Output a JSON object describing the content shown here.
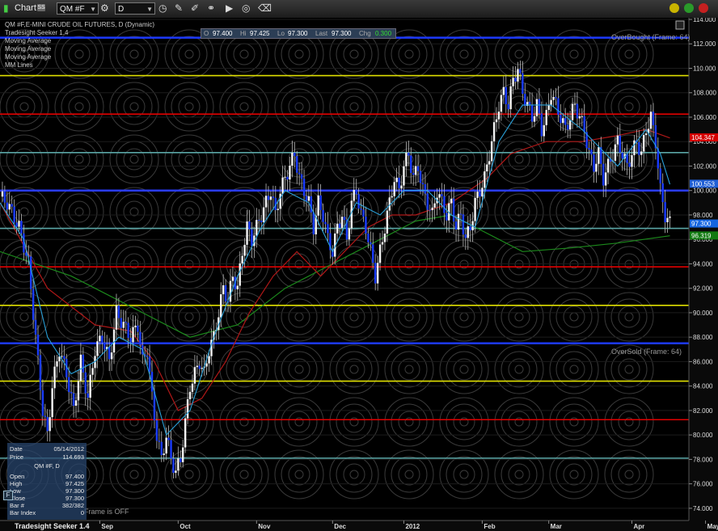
{
  "toolbar": {
    "title": "Chart",
    "badge": "SS",
    "symbol": "QM #F",
    "period": "D",
    "icons": [
      "link-icon",
      "crosshair-icon",
      "pencil-icon",
      "draw-icon",
      "play-icon",
      "target-icon",
      "eraser-icon"
    ]
  },
  "legend": {
    "title": "QM #F,E-MINI CRUDE OIL FUTURES, D (Dynamic)",
    "lines": [
      "Tradesight Seeker 1.4",
      "Moving Average",
      "Moving Average",
      "Moving Average",
      "MM Lines"
    ]
  },
  "ohlc": {
    "o_label": "O",
    "o": "97.400",
    "h_label": "Hi",
    "h": "97.425",
    "l_label": "Lo",
    "l": "97.300",
    "last_label": "Last",
    "last": "97.300",
    "chg_label": "Chg",
    "chg": "0.300"
  },
  "labels": {
    "overbought": "OverBought (Frame: 64)",
    "oversold": "OverSold (Frame: 64)",
    "frame_off": "Frame is OFF",
    "footer": "Tradesight Seeker 1.4"
  },
  "info_panel": {
    "date_label": "Date",
    "date": "05/14/2012",
    "price_label": "Price",
    "price": "114.693",
    "symbol": "QM #F, D",
    "rows": [
      {
        "label": "Open",
        "value": "97.400"
      },
      {
        "label": "High",
        "value": "97.425"
      },
      {
        "label": "Low",
        "value": "97.300"
      },
      {
        "label": "Close",
        "value": "97.300"
      },
      {
        "label": "Bar #",
        "value": "382/382"
      },
      {
        "label": "Bar Index",
        "value": "0"
      }
    ]
  },
  "price_tags": [
    {
      "value": "104.347",
      "color": "#d40000"
    },
    {
      "value": "100.553",
      "color": "#1f5fd6"
    },
    {
      "value": "97.300",
      "color": "#1565e0"
    },
    {
      "value": "96.319",
      "color": "#117a11"
    }
  ],
  "chart_data": {
    "type": "candlestick",
    "title": "QM #F,E-MINI CRUDE OIL FUTURES, D (Dynamic)",
    "ylim": [
      73,
      114
    ],
    "y_ticks": [
      74,
      76,
      78,
      80,
      82,
      84,
      86,
      88,
      90,
      92,
      94,
      96,
      98,
      100,
      102,
      104,
      106,
      108,
      110,
      112,
      114
    ],
    "x_ticks": [
      "Sep",
      "Oct",
      "Nov",
      "Dec",
      "2012",
      "Feb",
      "Mar",
      "Apr",
      "May"
    ],
    "x_tick_index": [
      42,
      75,
      108,
      140,
      170,
      203,
      231,
      266,
      297
    ],
    "mm_lines": [
      {
        "value": 112.5,
        "color": "#1d39ff"
      },
      {
        "value": 109.4,
        "color": "#e0e000"
      },
      {
        "value": 106.25,
        "color": "#e00000"
      },
      {
        "value": 103.1,
        "color": "#5aa6a6"
      },
      {
        "value": 100.0,
        "color": "#2a3cff"
      },
      {
        "value": 96.9,
        "color": "#5aa6a6"
      },
      {
        "value": 93.75,
        "color": "#e00000"
      },
      {
        "value": 90.6,
        "color": "#e0e000"
      },
      {
        "value": 87.5,
        "color": "#1d39ff"
      },
      {
        "value": 84.4,
        "color": "#e0e000"
      },
      {
        "value": 81.25,
        "color": "#e00000"
      },
      {
        "value": 78.1,
        "color": "#5aa6a6"
      }
    ],
    "close_path": [
      [
        0,
        99.5
      ],
      [
        3,
        99
      ],
      [
        8,
        97
      ],
      [
        12,
        94
      ],
      [
        14,
        90
      ],
      [
        16,
        86
      ],
      [
        18,
        82
      ],
      [
        20,
        80
      ],
      [
        22,
        84
      ],
      [
        25,
        87
      ],
      [
        28,
        85
      ],
      [
        31,
        82
      ],
      [
        34,
        86
      ],
      [
        37,
        83
      ],
      [
        40,
        87
      ],
      [
        43,
        88
      ],
      [
        46,
        86
      ],
      [
        49,
        90
      ],
      [
        52,
        89
      ],
      [
        55,
        88
      ],
      [
        58,
        89
      ],
      [
        60,
        86
      ],
      [
        62,
        87
      ],
      [
        64,
        83
      ],
      [
        66,
        80
      ],
      [
        68,
        78
      ],
      [
        70,
        80
      ],
      [
        72,
        78
      ],
      [
        74,
        77
      ],
      [
        76,
        78
      ],
      [
        78,
        81
      ],
      [
        80,
        84
      ],
      [
        82,
        85
      ],
      [
        84,
        86
      ],
      [
        86,
        85
      ],
      [
        88,
        87
      ],
      [
        90,
        88
      ],
      [
        92,
        90
      ],
      [
        94,
        92
      ],
      [
        96,
        91
      ],
      [
        98,
        93
      ],
      [
        100,
        92
      ],
      [
        102,
        95
      ],
      [
        104,
        97
      ],
      [
        106,
        96
      ],
      [
        108,
        97
      ],
      [
        110,
        98
      ],
      [
        112,
        99
      ],
      [
        114,
        100
      ],
      [
        116,
        98
      ],
      [
        118,
        100
      ],
      [
        120,
        101
      ],
      [
        122,
        102
      ],
      [
        124,
        103
      ],
      [
        126,
        101
      ],
      [
        128,
        100
      ],
      [
        130,
        99
      ],
      [
        132,
        97
      ],
      [
        134,
        99
      ],
      [
        136,
        98
      ],
      [
        138,
        96
      ],
      [
        140,
        95
      ],
      [
        142,
        97
      ],
      [
        144,
        98
      ],
      [
        146,
        96
      ],
      [
        148,
        99
      ],
      [
        150,
        100
      ],
      [
        152,
        98
      ],
      [
        154,
        97
      ],
      [
        156,
        95
      ],
      [
        158,
        93
      ],
      [
        160,
        95
      ],
      [
        162,
        97
      ],
      [
        164,
        99
      ],
      [
        166,
        101
      ],
      [
        168,
        100
      ],
      [
        170,
        102
      ],
      [
        172,
        103
      ],
      [
        174,
        101
      ],
      [
        176,
        102
      ],
      [
        178,
        100
      ],
      [
        180,
        99
      ],
      [
        182,
        98
      ],
      [
        184,
        100
      ],
      [
        186,
        99
      ],
      [
        188,
        98
      ],
      [
        190,
        99
      ],
      [
        192,
        97
      ],
      [
        194,
        98
      ],
      [
        196,
        96
      ],
      [
        198,
        97
      ],
      [
        200,
        99
      ],
      [
        202,
        100
      ],
      [
        204,
        101
      ],
      [
        206,
        103
      ],
      [
        208,
        105
      ],
      [
        210,
        107
      ],
      [
        212,
        108
      ],
      [
        214,
        107
      ],
      [
        216,
        109
      ],
      [
        218,
        110
      ],
      [
        220,
        108
      ],
      [
        222,
        107
      ],
      [
        224,
        106
      ],
      [
        226,
        107
      ],
      [
        228,
        105
      ],
      [
        230,
        106
      ],
      [
        232,
        108
      ],
      [
        234,
        107
      ],
      [
        236,
        106
      ],
      [
        238,
        105
      ],
      [
        240,
        106
      ],
      [
        242,
        107
      ],
      [
        244,
        106
      ],
      [
        246,
        105
      ],
      [
        248,
        103
      ],
      [
        250,
        102
      ],
      [
        252,
        103
      ],
      [
        254,
        101
      ],
      [
        256,
        102
      ],
      [
        258,
        103
      ],
      [
        260,
        104
      ],
      [
        262,
        103
      ],
      [
        264,
        102
      ],
      [
        266,
        103
      ],
      [
        268,
        104
      ],
      [
        270,
        103
      ],
      [
        272,
        105
      ],
      [
        274,
        106
      ],
      [
        276,
        104
      ],
      [
        278,
        100
      ],
      [
        280,
        98
      ],
      [
        282,
        97.3
      ]
    ],
    "ma_slow": [
      [
        0,
        95
      ],
      [
        30,
        93
      ],
      [
        60,
        90
      ],
      [
        80,
        88
      ],
      [
        100,
        89
      ],
      [
        120,
        92
      ],
      [
        140,
        94
      ],
      [
        160,
        96
      ],
      [
        175,
        97.5
      ],
      [
        190,
        98
      ],
      [
        205,
        96.5
      ],
      [
        220,
        95
      ],
      [
        240,
        95.3
      ],
      [
        260,
        95.7
      ],
      [
        282,
        96.3
      ]
    ],
    "ma_mid": [
      [
        0,
        99
      ],
      [
        20,
        92
      ],
      [
        40,
        89
      ],
      [
        55,
        88.5
      ],
      [
        65,
        86
      ],
      [
        75,
        82
      ],
      [
        85,
        83
      ],
      [
        95,
        86
      ],
      [
        105,
        90
      ],
      [
        115,
        93
      ],
      [
        125,
        95
      ],
      [
        135,
        93
      ],
      [
        145,
        95
      ],
      [
        155,
        97
      ],
      [
        165,
        98
      ],
      [
        175,
        98
      ],
      [
        190,
        99
      ],
      [
        205,
        101
      ],
      [
        215,
        103
      ],
      [
        230,
        104
      ],
      [
        245,
        104
      ],
      [
        260,
        104.5
      ],
      [
        272,
        105
      ],
      [
        282,
        104.3
      ]
    ],
    "ma_fast": [
      [
        0,
        99
      ],
      [
        10,
        96
      ],
      [
        20,
        88
      ],
      [
        30,
        85
      ],
      [
        40,
        86
      ],
      [
        50,
        88
      ],
      [
        60,
        87
      ],
      [
        70,
        80
      ],
      [
        80,
        82
      ],
      [
        90,
        88
      ],
      [
        100,
        93
      ],
      [
        110,
        97
      ],
      [
        120,
        100
      ],
      [
        130,
        99
      ],
      [
        140,
        95
      ],
      [
        150,
        99
      ],
      [
        160,
        98
      ],
      [
        170,
        100
      ],
      [
        180,
        100
      ],
      [
        190,
        98
      ],
      [
        200,
        97
      ],
      [
        210,
        104
      ],
      [
        220,
        107
      ],
      [
        232,
        107
      ],
      [
        245,
        105
      ],
      [
        260,
        102
      ],
      [
        272,
        105
      ],
      [
        278,
        103
      ],
      [
        282,
        100.5
      ]
    ]
  }
}
